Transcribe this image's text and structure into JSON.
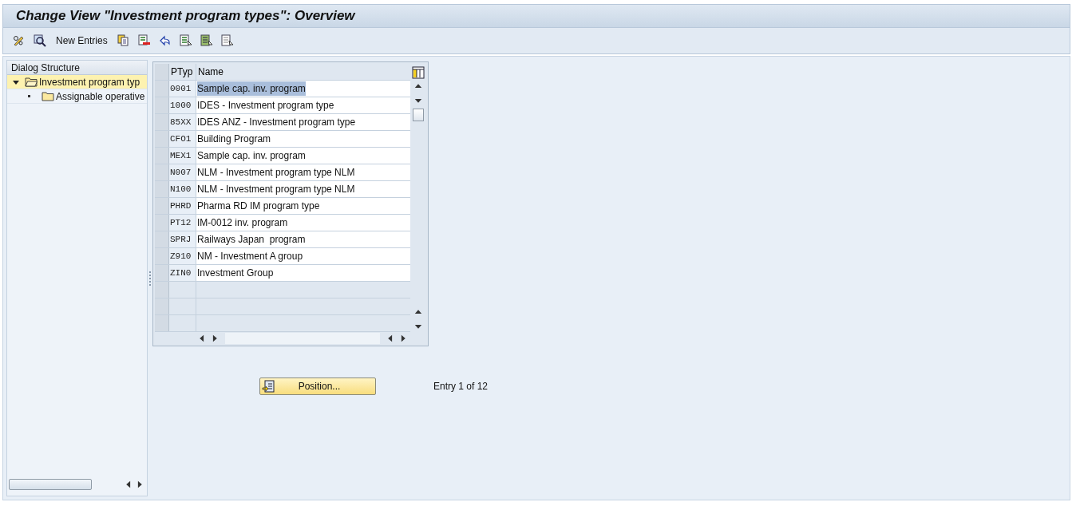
{
  "window": {
    "title": "Change View \"Investment program types\": Overview"
  },
  "toolbar": {
    "items": [
      {
        "kind": "icon"
      },
      {
        "kind": "icon"
      },
      {
        "kind": "text",
        "label": "New Entries"
      },
      {
        "kind": "icon"
      },
      {
        "kind": "icon"
      },
      {
        "kind": "icon"
      },
      {
        "kind": "icon"
      },
      {
        "kind": "icon"
      },
      {
        "kind": "icon"
      }
    ]
  },
  "dialog_structure": {
    "title": "Dialog Structure",
    "items": [
      {
        "label": "Investment program typ",
        "expanded": true,
        "selected": true,
        "children": [
          {
            "label": "Assignable operative",
            "selected": false
          }
        ]
      }
    ]
  },
  "table": {
    "columns": [
      "PTyp",
      "Name"
    ],
    "rows": [
      {
        "code": "0001",
        "name": "Sample cap. inv. program",
        "selected": true
      },
      {
        "code": "1000",
        "name": "IDES - Investment program type",
        "selected": false
      },
      {
        "code": "85XX",
        "name": "IDES ANZ - Investment program type",
        "selected": false
      },
      {
        "code": "CFO1",
        "name": "Building Program",
        "selected": false
      },
      {
        "code": "MEX1",
        "name": "Sample cap. inv. program",
        "selected": false
      },
      {
        "code": "N007",
        "name": "NLM - Investment program type NLM",
        "selected": false
      },
      {
        "code": "N100",
        "name": "NLM - Investment program type NLM",
        "selected": false
      },
      {
        "code": "PHRD",
        "name": "Pharma RD IM program type",
        "selected": false
      },
      {
        "code": "PT12",
        "name": "IM-0012 inv. program",
        "selected": false
      },
      {
        "code": "SPRJ",
        "name": "Railways Japan  program",
        "selected": false
      },
      {
        "code": "Z910",
        "name": "NM - Investment A group",
        "selected": false
      },
      {
        "code": "ZIN0",
        "name": "Investment Group",
        "selected": false
      }
    ]
  },
  "position_button": {
    "label": "Position..."
  },
  "entry_info": "Entry 1 of 12"
}
